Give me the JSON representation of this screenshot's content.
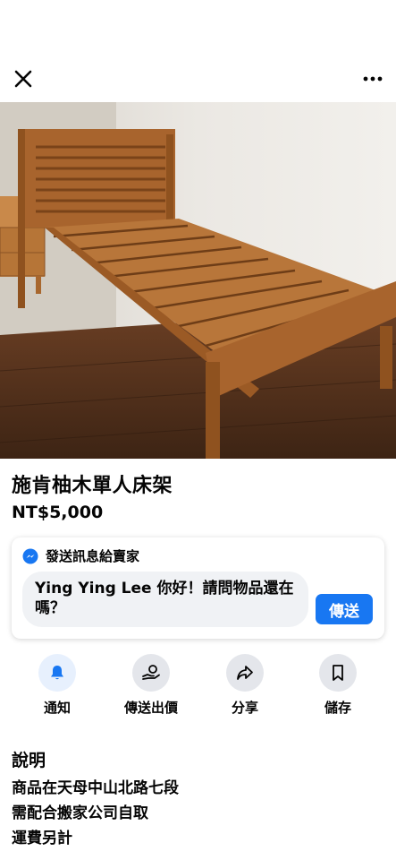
{
  "header": {
    "close_icon": "close-icon",
    "more_icon": "more-dots-icon"
  },
  "listing": {
    "title": "施肯柚木單人床架",
    "price": "NT$5,000",
    "photo_description": "wooden-single-bed-frame"
  },
  "message": {
    "heading": "發送訊息給賣家",
    "input_value": "Ying Ying Lee 你好！請問物品還在嗎？",
    "send_label": "傳送",
    "messenger_color": "#1877f2"
  },
  "actions": [
    {
      "label": "通知",
      "icon": "bell-icon"
    },
    {
      "label": "傳送出價",
      "icon": "offer-icon"
    },
    {
      "label": "分享",
      "icon": "share-icon"
    },
    {
      "label": "儲存",
      "icon": "bookmark-icon"
    }
  ],
  "description": {
    "heading": "說明",
    "lines": [
      "商品在天母中山北路七段",
      "需配合搬家公司自取",
      "運費另計"
    ]
  },
  "colors": {
    "accent": "#1877f2",
    "text": "#050505",
    "input_bg": "#f0f2f5"
  }
}
